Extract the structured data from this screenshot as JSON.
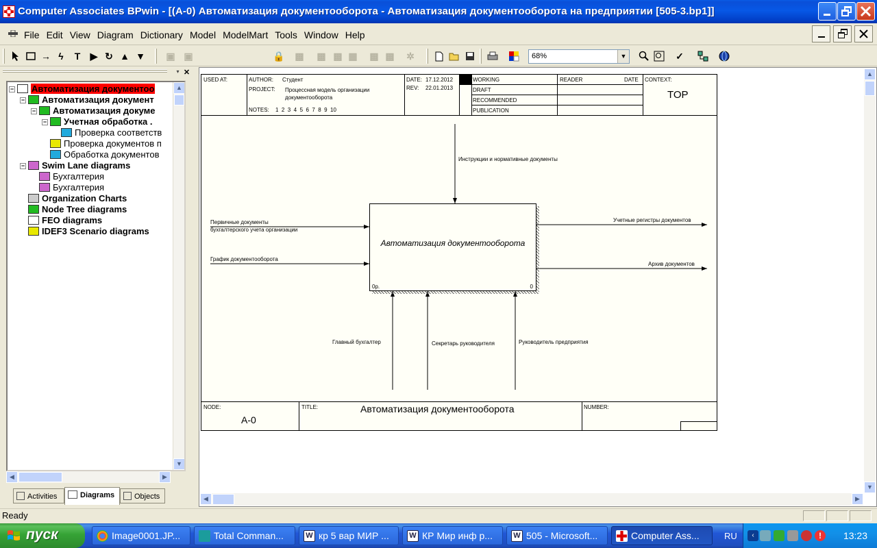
{
  "window": {
    "title": "Computer Associates BPwin - [(A-0) Автоматизация документооборота  - Автоматизация документооборота на предприятии  [505-3.bp1]]"
  },
  "menu": [
    "File",
    "Edit",
    "View",
    "Diagram",
    "Dictionary",
    "Model",
    "ModelMart",
    "Tools",
    "Window",
    "Help"
  ],
  "toolbar": {
    "zoom": "68%"
  },
  "tree": {
    "items": [
      {
        "label": "Автоматизация документоо",
        "level": 0,
        "bold": true,
        "selected": true,
        "icon": "model-icon"
      },
      {
        "label": "Автоматизация документ",
        "level": 1,
        "bold": true,
        "icon": "idef0-diagram-icon"
      },
      {
        "label": "Автоматизация докуме",
        "level": 2,
        "bold": true,
        "icon": "idef0-diagram-icon"
      },
      {
        "label": "Учетная обработка .",
        "level": 3,
        "bold": true,
        "icon": "idef0-diagram-icon"
      },
      {
        "label": "Проверка соответств",
        "level": 4,
        "bold": false,
        "icon": "dfd-diagram-icon"
      },
      {
        "label": "Проверка документов п",
        "level": 3,
        "bold": false,
        "icon": "idef3-diagram-icon"
      },
      {
        "label": "Обработка документов",
        "level": 3,
        "bold": false,
        "icon": "dfd-diagram-icon"
      },
      {
        "label": "Swim Lane diagrams",
        "level": 1,
        "bold": true,
        "icon": "swimlane-icon"
      },
      {
        "label": "Бухгалтерия",
        "level": 2,
        "bold": false,
        "icon": "swimlane-icon"
      },
      {
        "label": "Бухгалтерия",
        "level": 2,
        "bold": false,
        "icon": "swimlane-icon"
      },
      {
        "label": "Organization Charts",
        "level": 1,
        "bold": true,
        "icon": "org-chart-icon"
      },
      {
        "label": "Node Tree diagrams",
        "level": 1,
        "bold": true,
        "icon": "node-tree-icon"
      },
      {
        "label": "FEO diagrams",
        "level": 1,
        "bold": true,
        "icon": "feo-icon"
      },
      {
        "label": "IDEF3 Scenario diagrams",
        "level": 1,
        "bold": true,
        "icon": "idef3-scenario-icon"
      }
    ],
    "tabs": [
      "Activities",
      "Diagrams",
      "Objects"
    ],
    "active_tab": "Diagrams"
  },
  "diagram": {
    "header": {
      "used_at": "USED AT:",
      "author_label": "AUTHOR:",
      "author": "Студент",
      "project_label": "PROJECT:",
      "project": "Процессная модель организации документооборота",
      "notes_label": "NOTES:",
      "notes": "1  2  3  4  5  6  7  8  9  10",
      "date_label": "DATE:",
      "date": "17.12.2012",
      "rev_label": "REV:",
      "rev": "22.01.2013",
      "status": [
        "WORKING",
        "DRAFT",
        "RECOMMENDED",
        "PUBLICATION"
      ],
      "reader": "READER",
      "reader_date": "DATE",
      "context_label": "CONTEXT:",
      "context": "TOP"
    },
    "function": {
      "title": "Автоматизация документооборота",
      "cost": "0р.",
      "number": "0"
    },
    "arrows": {
      "control": "Инструкции и нормативные документы",
      "input1_line1": "Первичные документы",
      "input1_line2": "бухгалтерского учета организации",
      "input2": "График документооборота",
      "output1": "Учетные регистры документов",
      "output2": "Архив документов",
      "mech1": "Главный бухгалтер",
      "mech2": "Секретарь руководителя",
      "mech3": "Руководитель предприятия"
    },
    "footer": {
      "node_label": "NODE:",
      "node": "A-0",
      "title_label": "TITLE:",
      "title": "Автоматизация документооборота",
      "number_label": "NUMBER:"
    }
  },
  "status": {
    "text": "Ready"
  },
  "taskbar": {
    "start": "пуск",
    "tasks": [
      "Image0001.JP...",
      "Total Comman...",
      "кр 5 вар МИР ...",
      "КР Мир инф р...",
      "505 - Microsoft...",
      "Computer Ass..."
    ],
    "lang": "RU",
    "clock": "13:23"
  }
}
